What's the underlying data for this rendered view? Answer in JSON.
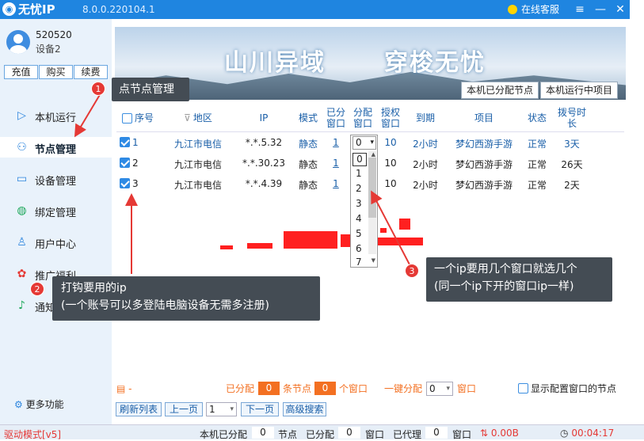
{
  "window": {
    "title": "无忧IP",
    "version": "8.0.0.220104.1",
    "customer_service": "在线客服"
  },
  "user": {
    "name": "520520",
    "device": "设备2"
  },
  "account_buttons": [
    "充值",
    "购买",
    "续费"
  ],
  "nav": [
    {
      "label": "本机运行",
      "icon": "play-icon"
    },
    {
      "label": "节点管理",
      "icon": "nodes-icon"
    },
    {
      "label": "设备管理",
      "icon": "device-icon"
    },
    {
      "label": "绑定管理",
      "icon": "bind-icon"
    },
    {
      "label": "用户中心",
      "icon": "user-icon"
    },
    {
      "label": "推广福利",
      "icon": "gift-icon"
    },
    {
      "label": "通知公告",
      "icon": "bell-icon"
    }
  ],
  "more": "更多功能",
  "banner": {
    "left": "山川异域",
    "right": "穿梭无忧"
  },
  "tabs": [
    "本机已分配节点",
    "本机运行中项目"
  ],
  "table": {
    "headers": [
      "序号",
      "地区",
      "IP",
      "模式",
      "已分窗口",
      "分配窗口",
      "授权窗口",
      "到期",
      "项目",
      "状态",
      "拨号时长"
    ],
    "rows": [
      {
        "no": "1",
        "region": "九江市电信",
        "ip": "*.*.5.32",
        "mode": "静态",
        "used": "1",
        "assign": "0",
        "auth": "10",
        "expire": "2小时",
        "project": "梦幻西游手游",
        "status": "正常",
        "dial": "3天"
      },
      {
        "no": "2",
        "region": "九江市电信",
        "ip": "*.*.30.23",
        "mode": "静态",
        "used": "1",
        "assign": "",
        "auth": "10",
        "expire": "2小时",
        "project": "梦幻西游手游",
        "status": "正常",
        "dial": "26天"
      },
      {
        "no": "3",
        "region": "九江市电信",
        "ip": "*.*.4.39",
        "mode": "静态",
        "used": "1",
        "assign": "",
        "auth": "10",
        "expire": "2小时",
        "project": "梦幻西游手游",
        "status": "正常",
        "dial": "2天"
      }
    ]
  },
  "dropdown": {
    "selected": "0",
    "options": [
      "1",
      "2",
      "3",
      "4",
      "5",
      "6",
      "7"
    ]
  },
  "annotations": {
    "a1": "点节点管理",
    "a2_line1": "打钩要用的ip",
    "a2_line2": "(一个账号可以多登陆电脑设备无需多注册)",
    "a3_line1": "一个ip要用几个窗口就选几个",
    "a3_line2": "(同一个ip下开的窗口ip一样)"
  },
  "footer": {
    "hint": "-",
    "assigned_label": "已分配",
    "nodes_value": "0",
    "nodes_label": "条节点",
    "windows_value": "0",
    "windows_label": "个窗口",
    "one_key_label": "一键分配",
    "one_key_value": "0",
    "one_key_unit": "窗口",
    "show_config": "显示配置窗口的节点",
    "refresh": "刷新列表",
    "prev": "上一页",
    "page": "1",
    "next": "下一页",
    "adv": "高级搜索"
  },
  "status": {
    "mode": "驱动模式[v5]",
    "node_assigned_label": "本机已分配",
    "node_assigned": "0",
    "node_label": "节点",
    "win_assigned_label": "已分配",
    "win_assigned": "0",
    "win_label": "窗口",
    "proxied_label": "已代理",
    "proxied": "0",
    "proxied_unit": "窗口",
    "traffic": "0.00B",
    "time": "00:04:17"
  },
  "colors": {
    "accent": "#1f85e0",
    "orange": "#f37022",
    "annotation_bg": "#444c54",
    "badge": "#e53935"
  }
}
